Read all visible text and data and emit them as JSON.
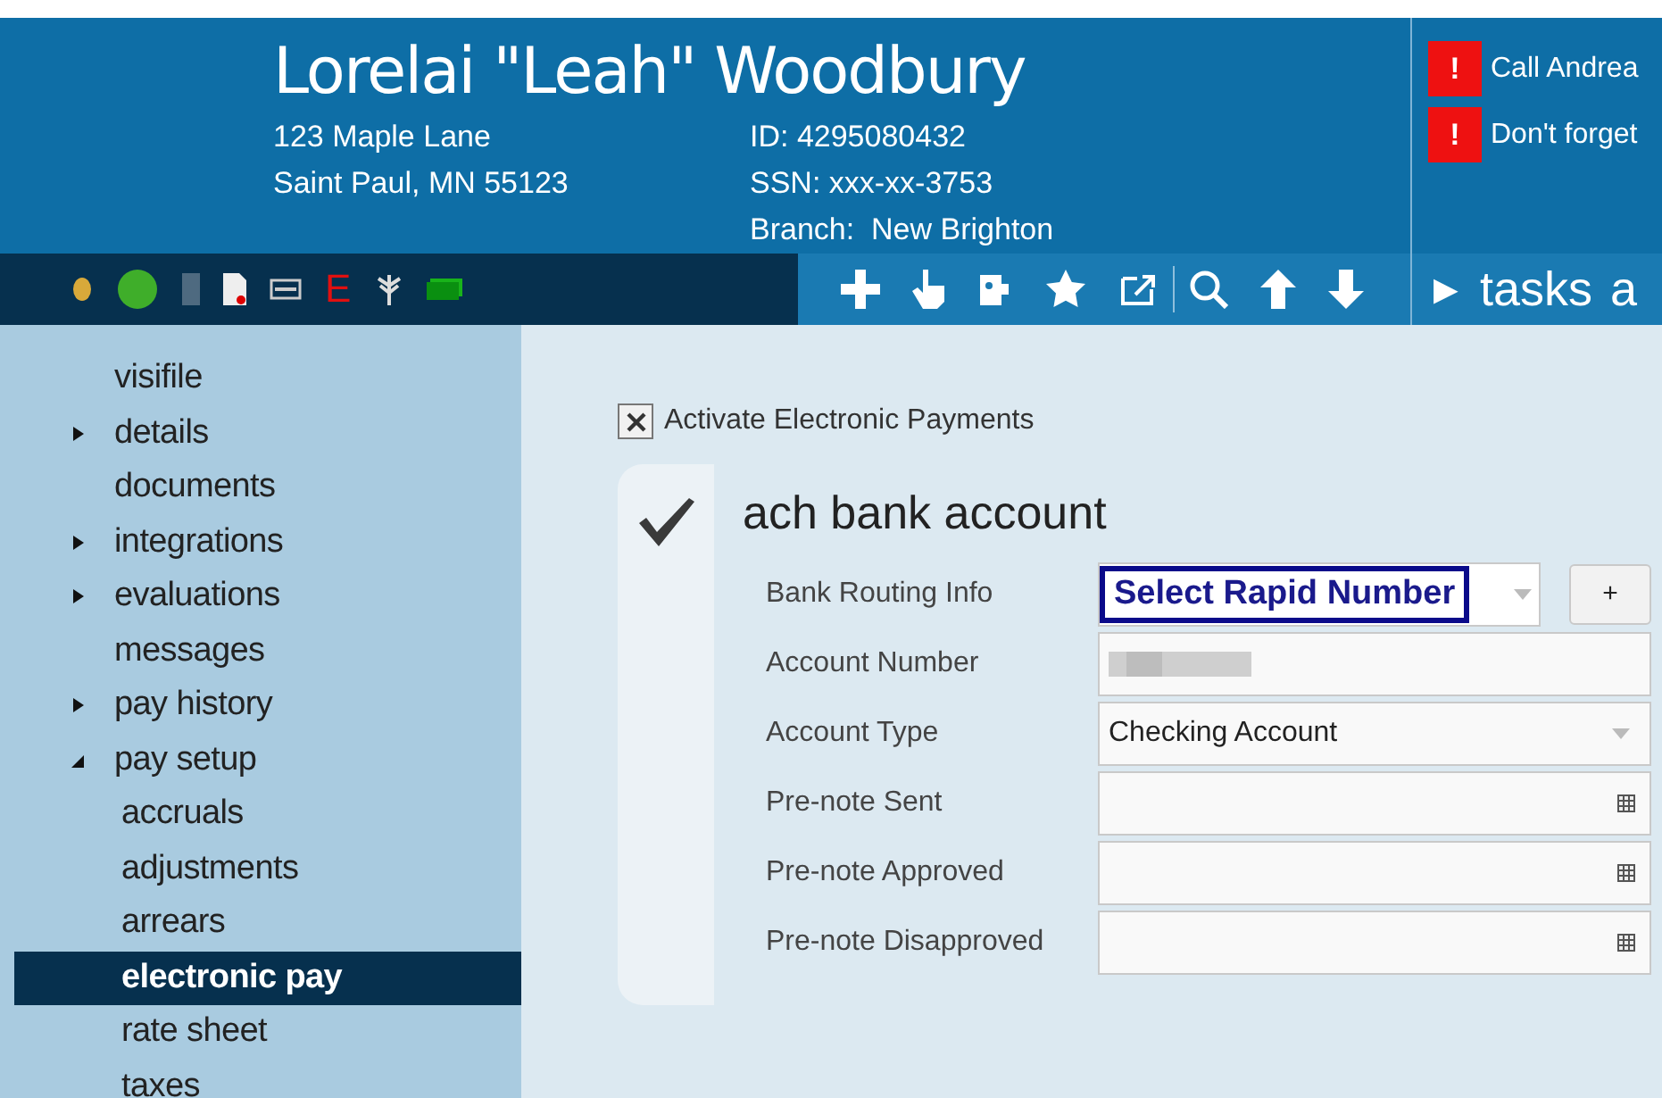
{
  "header": {
    "name": "Lorelai \"Leah\" Woodbury",
    "address": [
      "123 Maple Lane",
      "Saint Paul, MN 55123"
    ],
    "ids": [
      "ID: 4295080432",
      "SSN: xxx-xx-3753",
      "Branch:  New Brighton"
    ]
  },
  "alerts": [
    {
      "mark": "!",
      "text": "Call Andrea"
    },
    {
      "mark": "!",
      "text": "Don't forget"
    }
  ],
  "toolbar": {
    "letter": "E",
    "tasks_arrow": "▶",
    "tasks": "tasks",
    "cut_label": "a"
  },
  "sidebar": {
    "items": [
      {
        "label": "visifile",
        "selected": false
      },
      {
        "label": "details",
        "selected": false,
        "expanded": false
      },
      {
        "label": "documents",
        "selected": false
      },
      {
        "label": "integrations",
        "selected": false,
        "expanded": false
      },
      {
        "label": "evaluations",
        "selected": false,
        "expanded": false
      },
      {
        "label": "messages",
        "selected": false
      },
      {
        "label": "pay history",
        "selected": false,
        "expanded": false
      },
      {
        "label": "pay setup",
        "selected": false,
        "expanded": true,
        "children": [
          {
            "label": "accruals",
            "selected": false
          },
          {
            "label": "adjustments",
            "selected": false
          },
          {
            "label": "arrears",
            "selected": false
          },
          {
            "label": "electronic pay",
            "selected": true
          },
          {
            "label": "rate sheet",
            "selected": false
          },
          {
            "label": "taxes",
            "selected": false
          }
        ]
      }
    ]
  },
  "activate": {
    "label": "Activate Electronic Payments",
    "checked": true
  },
  "section": {
    "title": "ach bank account",
    "complete": true,
    "fields": [
      {
        "kind": "rapid",
        "label": "Bank Routing Info",
        "value": "Select Rapid Number",
        "add": "+"
      },
      {
        "kind": "redacted",
        "label": "Account Number"
      },
      {
        "kind": "select",
        "label": "Account Type",
        "value": "Checking Account"
      },
      {
        "kind": "date",
        "label": "Pre-note Sent"
      },
      {
        "kind": "date",
        "label": "Pre-note Approved"
      },
      {
        "kind": "date",
        "label": "Pre-note Disapproved"
      }
    ]
  }
}
